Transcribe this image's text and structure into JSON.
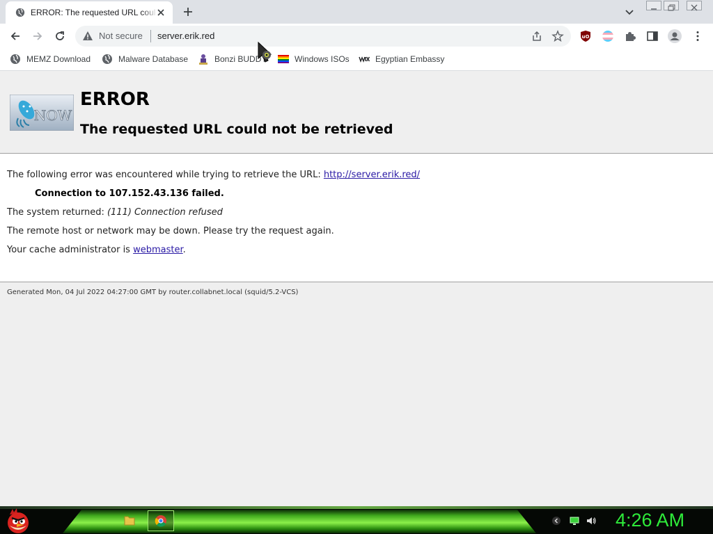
{
  "browser": {
    "tab": {
      "title": "ERROR: The requested URL could not be retrieved"
    },
    "address_bar": {
      "security_label": "Not secure",
      "url": "server.erik.red"
    }
  },
  "bookmarks": [
    {
      "label": "MEMZ Download",
      "icon": "globe-icon"
    },
    {
      "label": "Malware Database",
      "icon": "globe-icon"
    },
    {
      "label": "Bonzi BUDDY",
      "icon": "bonzi-icon"
    },
    {
      "label": "Windows ISOs",
      "icon": "rainbow-flag-icon"
    },
    {
      "label": "Egyptian Embassy",
      "icon": "wix-icon"
    }
  ],
  "page": {
    "heading": "ERROR",
    "subheading": "The requested URL could not be retrieved",
    "intro_text": "The following error was encountered while trying to retrieve the URL: ",
    "intro_link": "http://server.erik.red/",
    "connection_failed": "Connection to 107.152.43.136 failed.",
    "system_returned_label": "The system returned: ",
    "system_returned_value": "(111) Connection refused",
    "remote_host_text": "The remote host or network may be down. Please try the request again.",
    "cache_admin_text": "Your cache administrator is ",
    "cache_admin_link": "webmaster",
    "cache_admin_suffix": ".",
    "footer": "Generated Mon, 04 Jul 2022 04:27:00 GMT by router.collabnet.local (squid/5.2-VCS)",
    "logo_text": "NOW"
  },
  "taskbar": {
    "clock": "4:26 AM"
  },
  "colors": {
    "link": "#2a1aa5",
    "clock": "#2eea3a",
    "taskbar_glow": "#8bf04a"
  }
}
